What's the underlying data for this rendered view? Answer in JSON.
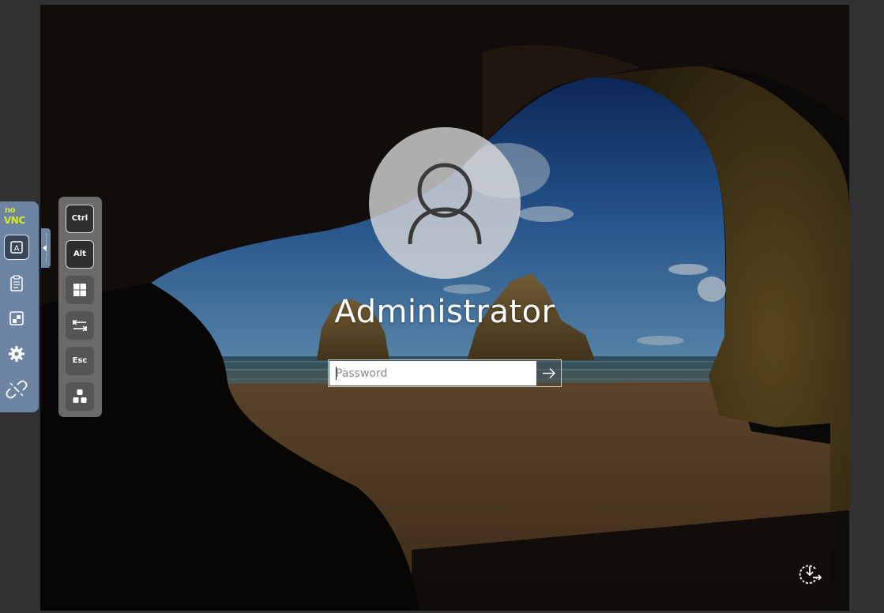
{
  "login": {
    "username": "Administrator",
    "password_placeholder": "Password",
    "password_value": ""
  },
  "novnc": {
    "logo_top": "no",
    "logo_bottom": "VNC",
    "toolbar": [
      {
        "name": "keyboard-button",
        "icon": "keyboard-icon"
      },
      {
        "name": "clipboard-button",
        "icon": "clipboard-icon"
      },
      {
        "name": "fullscreen-button",
        "icon": "fullscreen-icon"
      },
      {
        "name": "settings-button",
        "icon": "gear-icon"
      },
      {
        "name": "disconnect-button",
        "icon": "disconnect-icon"
      }
    ]
  },
  "extra_keys": {
    "ctrl": "Ctrl",
    "alt": "Alt",
    "esc": "Esc",
    "icon_keys": [
      "windows-icon",
      "tab-icon",
      "ctrl-alt-del-icon"
    ]
  },
  "colors": {
    "bar_blue": "#6e84a3",
    "logo_yellow": "#d6e92b",
    "keys_panel": "#6a6a6a"
  }
}
